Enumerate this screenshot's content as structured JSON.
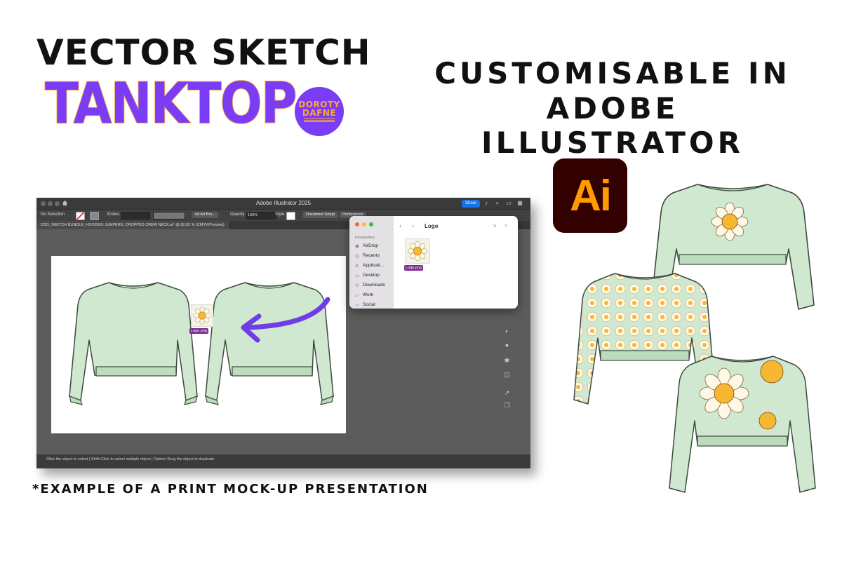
{
  "headline": {
    "line1": "VECTOR SKETCH",
    "line2": "TANKTOP",
    "brand_badge": [
      "DOROTY",
      "DAFNE"
    ],
    "subhead_lines": [
      "CUSTOMISABLE IN",
      "ADOBE ILLUSTRATOR"
    ],
    "footnote": "*EXAMPLE OF A PRINT MOCK-UP PRESENTATION"
  },
  "ai_logo": {
    "text": "Ai",
    "bg": "#330000",
    "fg": "#ff9a00"
  },
  "illustrator": {
    "app_title": "Adobe Illustrator 2025",
    "share_label": "Share",
    "control_bar": {
      "selection": "No Selection",
      "stroke_label": "Stroke:",
      "brush": "6d Art Bru...",
      "opacity_label": "Opacity:",
      "opacity_value": "100%",
      "style_label": "Style:",
      "doc_setup": "Document Setup",
      "preferences": "Preferences"
    },
    "doc_tab": "DDD_SKETCH BUNDLE_HOODIES JUMPERS_CROPPED CREW NECK.ai* @ 82,02 % (CMYK/Preview)",
    "status_text": "Click the object to select  |  Shift+Click to select multiple object  |  Option+Drag the object to duplicate",
    "placed_file_label": "Logo.png"
  },
  "finder": {
    "folder_title": "Logo",
    "section_header": "Favourites",
    "sidebar": [
      "AirDrop",
      "Recents",
      "Applicati...",
      "Desktop",
      "Downloads",
      "Work",
      "Social"
    ],
    "file_name": "Logo.png"
  },
  "colors": {
    "accent_purple": "#7b3cf6",
    "accent_orange": "#ffa63b",
    "garment_green": "#cfe8cf",
    "garment_outline": "#3d4a3d",
    "arrow": "#6f3ce8"
  }
}
